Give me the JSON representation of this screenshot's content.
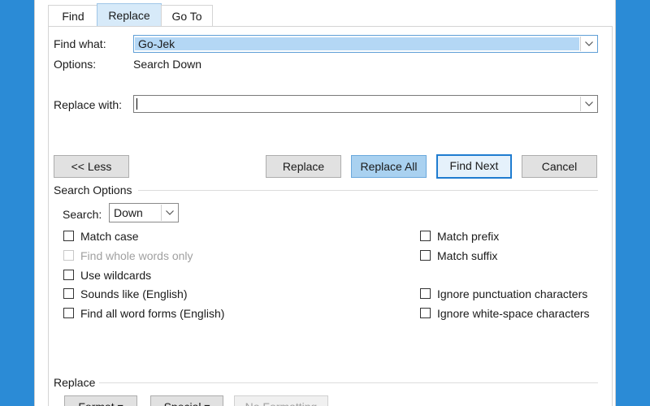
{
  "tabs": [
    {
      "label": "Find"
    },
    {
      "label": "Replace"
    },
    {
      "label": "Go To"
    }
  ],
  "find": {
    "label": "Find what:",
    "value": "Go-Jek",
    "options_label": "Options:",
    "options_value": "Search Down"
  },
  "replace": {
    "label": "Replace with:",
    "value": ""
  },
  "buttons": {
    "less": "<< Less",
    "replace": "Replace",
    "replace_all": "Replace All",
    "find_next": "Find Next",
    "cancel": "Cancel"
  },
  "search_options": {
    "heading": "Search Options",
    "search_label": "Search:",
    "search_value": "Down",
    "left": [
      {
        "label": "Match case",
        "checked": false,
        "enabled": true
      },
      {
        "label": "Find whole words only",
        "checked": false,
        "enabled": false
      },
      {
        "label": "Use wildcards",
        "checked": false,
        "enabled": true
      },
      {
        "label": "Sounds like (English)",
        "checked": false,
        "enabled": true
      },
      {
        "label": "Find all word forms (English)",
        "checked": false,
        "enabled": true
      }
    ],
    "right": [
      {
        "label": "Match prefix",
        "checked": false,
        "enabled": true
      },
      {
        "label": "Match suffix",
        "checked": false,
        "enabled": true
      },
      {
        "label": "Ignore punctuation characters",
        "checked": false,
        "enabled": true
      },
      {
        "label": "Ignore white-space characters",
        "checked": false,
        "enabled": true
      }
    ]
  },
  "replace_section": {
    "heading": "Replace",
    "format": "Format ▾",
    "special": "Special ▾",
    "no_formatting": "No Formatting"
  },
  "colors": {
    "background": "#2b8bd6",
    "accent": "#1f7cd0",
    "selection": "#b4d7f5"
  }
}
